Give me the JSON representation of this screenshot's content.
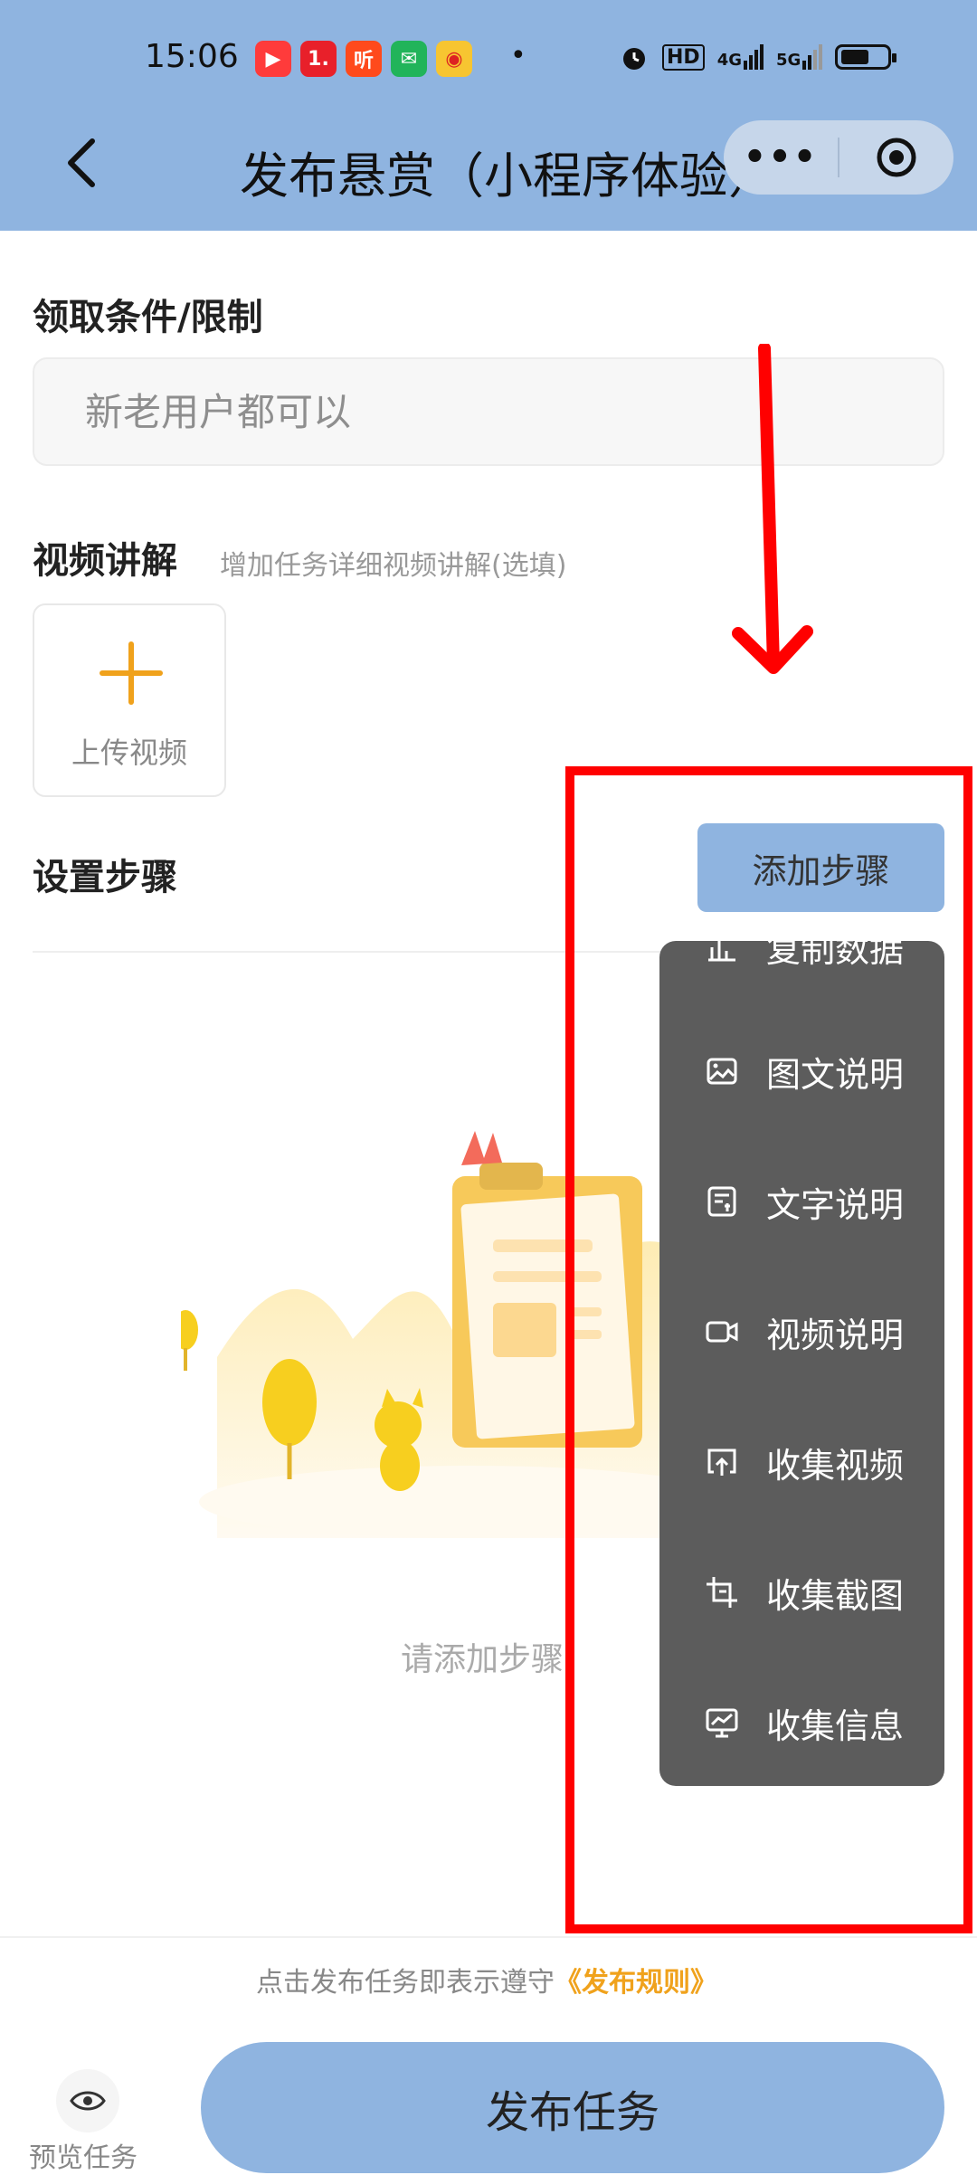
{
  "status_bar": {
    "time": "15:06",
    "app_badges": [
      "▶",
      "1.",
      "听",
      "✉",
      "◉"
    ],
    "dot": "•",
    "network_hd": "HD",
    "network_4g": "4G",
    "network_5g": "5G"
  },
  "header": {
    "title": "发布悬赏（小程序体验）",
    "capsule_more": "•••"
  },
  "conditions": {
    "label": "领取条件/限制",
    "placeholder": "新老用户都可以"
  },
  "video": {
    "label": "视频讲解",
    "hint": "增加任务详细视频讲解(选填)",
    "upload_label": "上传视频"
  },
  "steps": {
    "label": "设置步骤",
    "add_button": "添加步骤",
    "empty_text": "请添加步骤"
  },
  "menu": {
    "items": [
      {
        "label": "复制数据",
        "icon": "chart-icon"
      },
      {
        "label": "图文说明",
        "icon": "image-icon"
      },
      {
        "label": "文字说明",
        "icon": "text-doc-icon"
      },
      {
        "label": "视频说明",
        "icon": "video-camera-icon"
      },
      {
        "label": "收集视频",
        "icon": "upload-video-icon"
      },
      {
        "label": "收集截图",
        "icon": "crop-icon"
      },
      {
        "label": "收集信息",
        "icon": "monitor-chart-icon"
      }
    ]
  },
  "footer": {
    "rules_prefix": "点击发布任务即表示遵守",
    "rules_link": "《发布规则》",
    "preview_label": "预览任务",
    "publish_label": "发布任务"
  },
  "colors": {
    "header_bg": "#8fb4e0",
    "accent_orange": "#f0a21c",
    "menu_bg": "#5c5c5c",
    "annotation_red": "#ff0000"
  }
}
